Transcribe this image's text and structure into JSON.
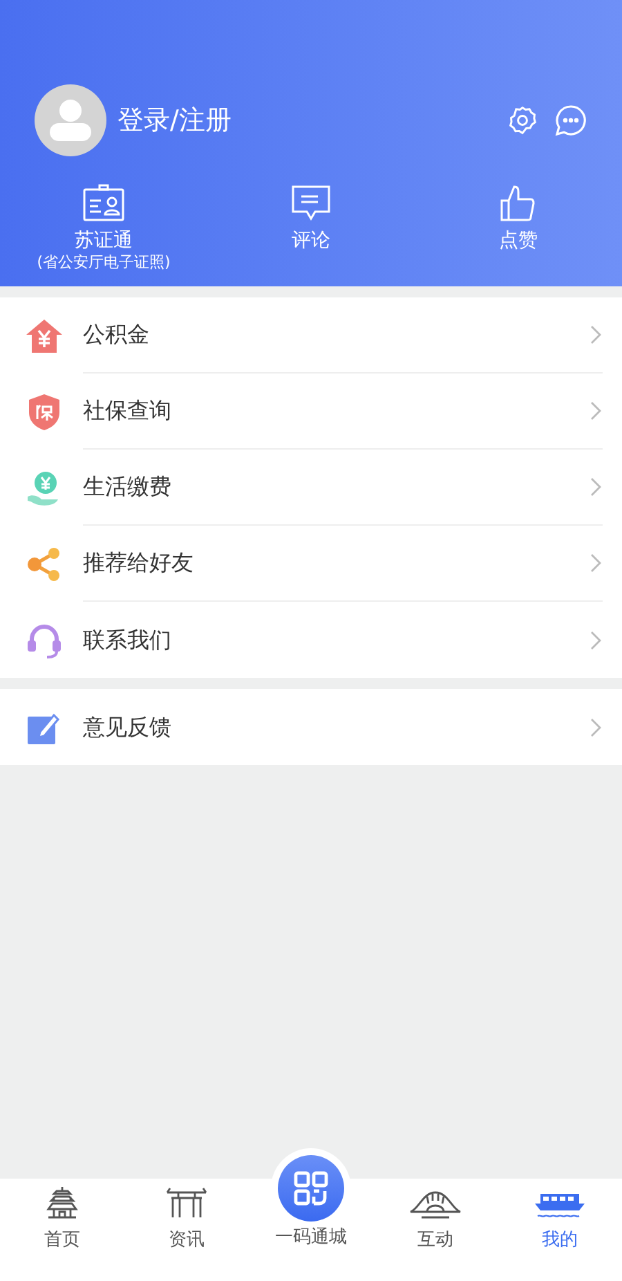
{
  "header": {
    "login_label": "登录/注册",
    "shortcuts": [
      {
        "kind": "id-card",
        "label": "苏证通",
        "sublabel": "(省公安厅电子证照)"
      },
      {
        "kind": "comment",
        "label": "评论"
      },
      {
        "kind": "like",
        "label": "点赞"
      }
    ]
  },
  "menu_groups": [
    [
      {
        "kind": "fund",
        "label": "公积金"
      },
      {
        "kind": "insurance",
        "label": "社保查询"
      },
      {
        "kind": "bill",
        "label": "生活缴费"
      },
      {
        "kind": "share",
        "label": "推荐给好友"
      },
      {
        "kind": "contact",
        "label": "联系我们"
      }
    ],
    [
      {
        "kind": "feedback",
        "label": "意见反馈"
      }
    ]
  ],
  "tab_bar": [
    {
      "kind": "pagoda",
      "label": "首页",
      "selected": false
    },
    {
      "kind": "gate",
      "label": "资讯",
      "selected": false
    },
    {
      "kind": "scan",
      "label": "一码通城",
      "selected": false
    },
    {
      "kind": "bridge",
      "label": "互动",
      "selected": false
    },
    {
      "kind": "boat",
      "label": "我的",
      "selected": true
    }
  ]
}
